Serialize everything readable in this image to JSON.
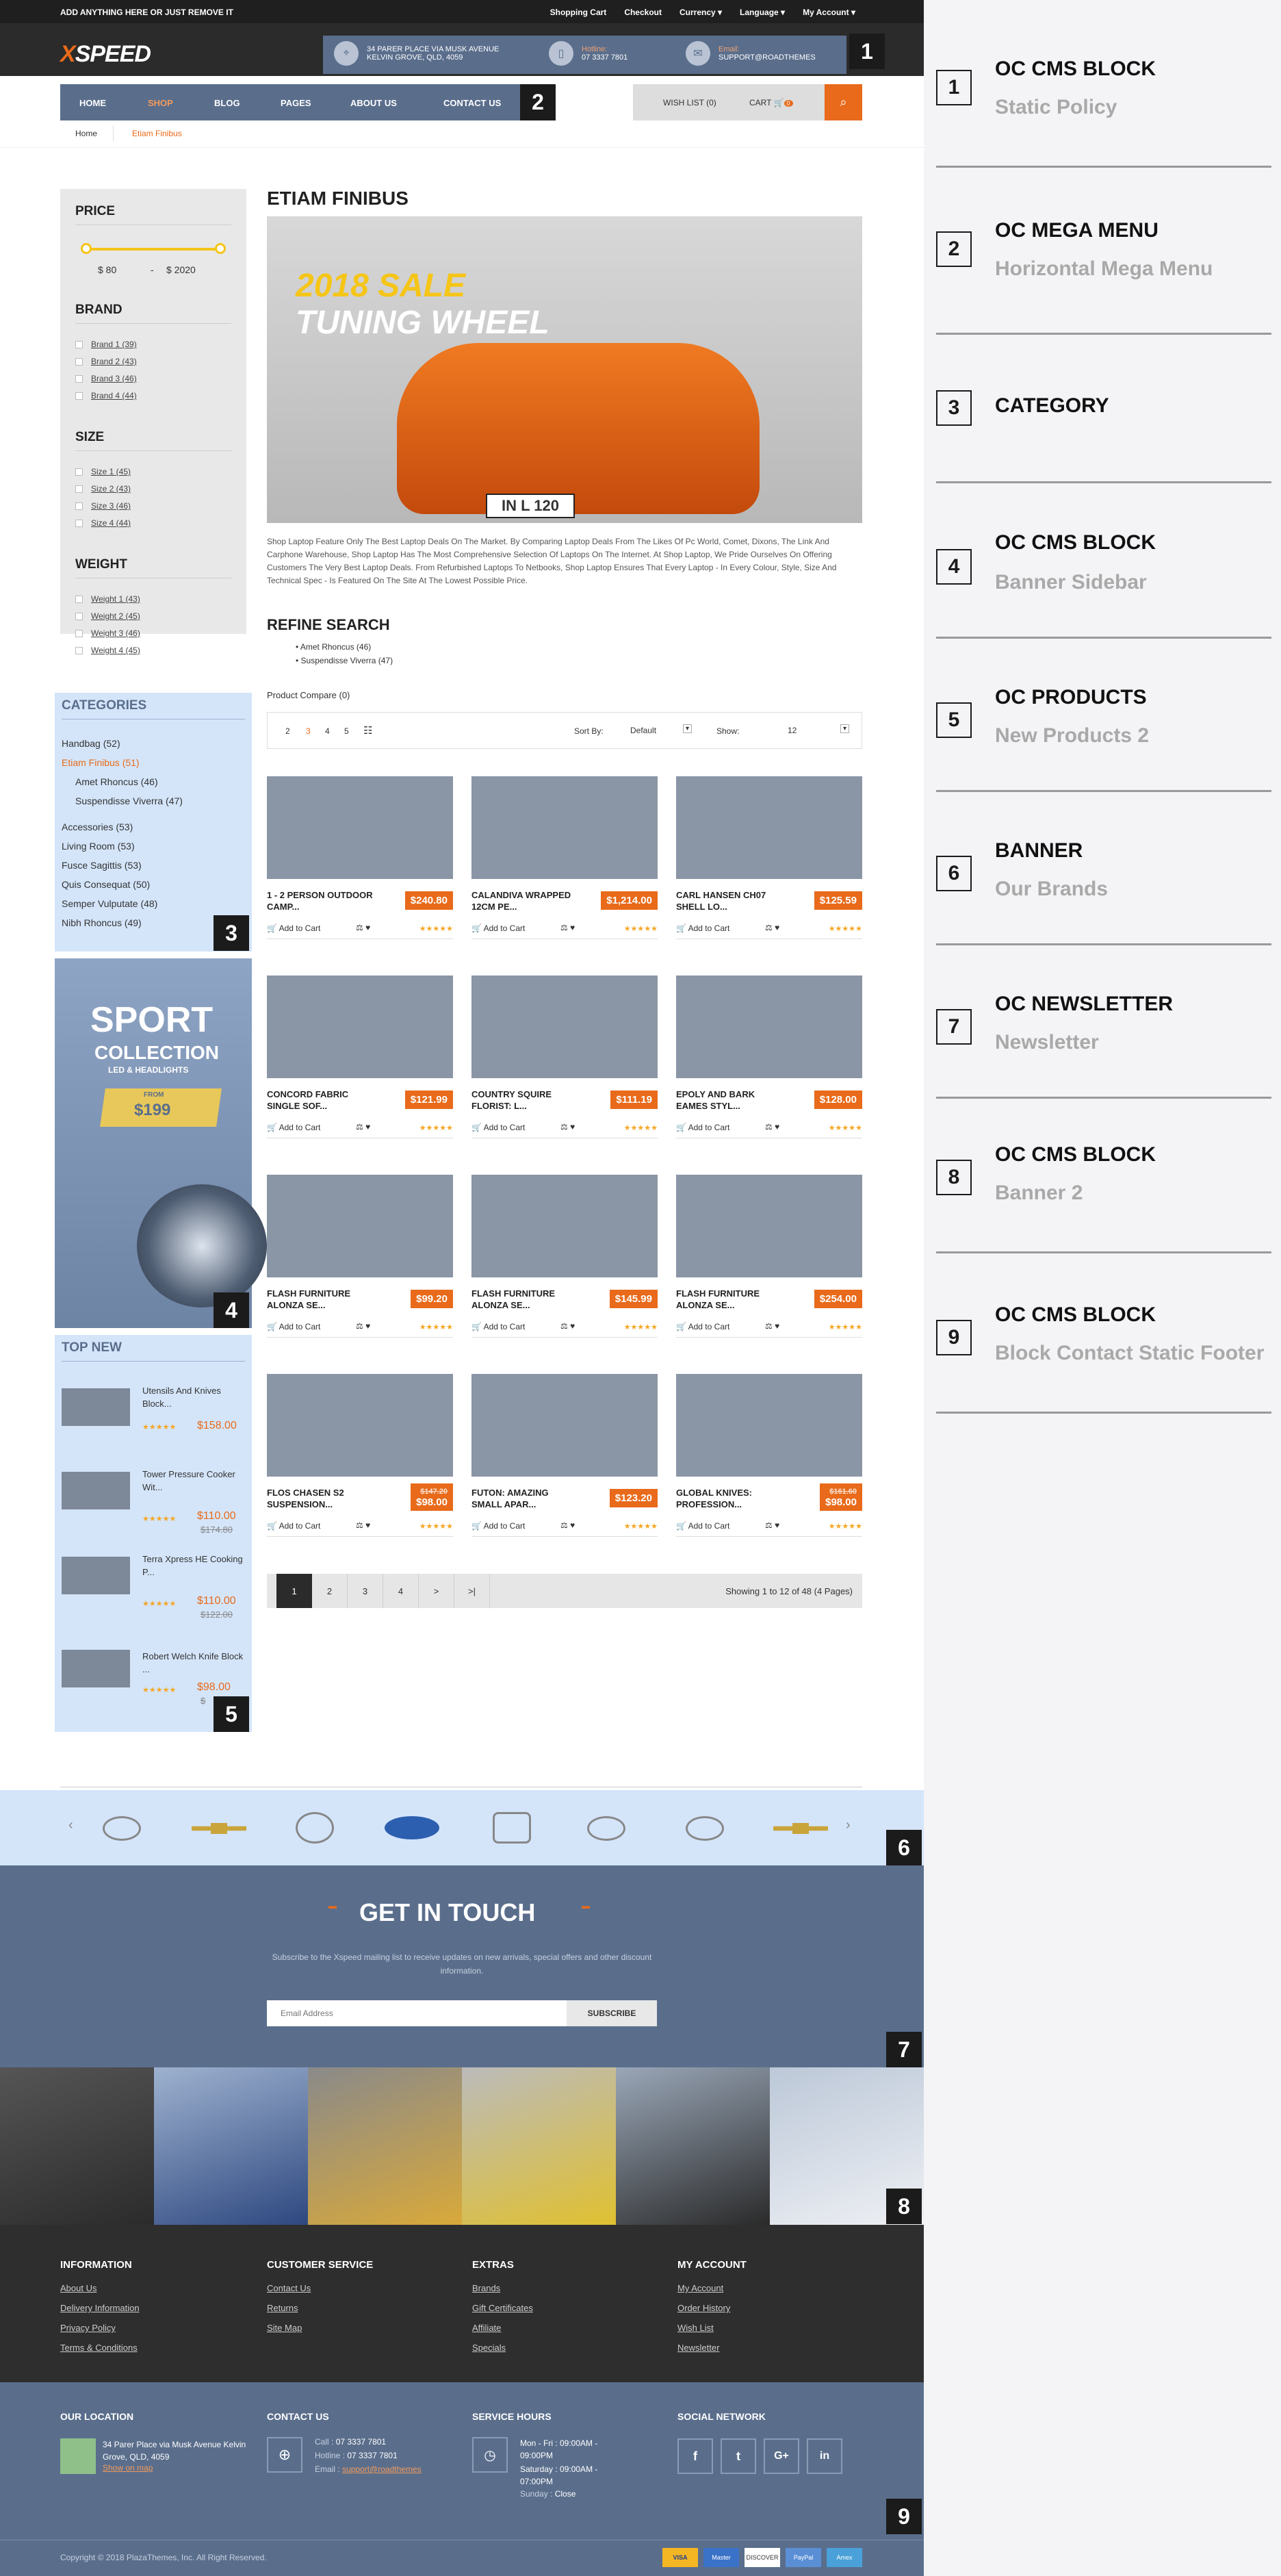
{
  "topbar": {
    "promo": "ADD ANYTHING HERE OR JUST REMOVE IT",
    "links": [
      "Shopping Cart",
      "Checkout",
      "Currency",
      "Language",
      "My Account"
    ]
  },
  "header": {
    "logo_x": "X",
    "logo_rest": "SPEED",
    "address": "34 PARER PLACE VIA MUSK AVENUE",
    "address2": "KELVIN GROVE, QLD, 4059",
    "hotline_label": "Hotline:",
    "hotline": "07 3337 7801",
    "email_label": "Email:",
    "email": "SUPPORT@ROADTHEMES"
  },
  "nav": {
    "items": [
      "HOME",
      "SHOP",
      "BLOG",
      "PAGES",
      "ABOUT US",
      "CONTACT US"
    ],
    "wishlist": "WISH LIST (0)",
    "cart": "CART",
    "cart_count": "0"
  },
  "breadcrumb": [
    "Home",
    "Etiam Finibus"
  ],
  "filter": {
    "price_title": "PRICE",
    "price_min": "$ 80",
    "price_sep": "-",
    "price_max": "$ 2020",
    "brand_title": "BRAND",
    "brands": [
      "Brand 1 (39)",
      "Brand 2 (43)",
      "Brand 3 (46)",
      "Brand 4 (44)"
    ],
    "size_title": "SIZE",
    "sizes": [
      "Size 1 (45)",
      "Size 2 (43)",
      "Size 3 (46)",
      "Size 4 (44)"
    ],
    "weight_title": "WEIGHT",
    "weights": [
      "Weight 1 (43)",
      "Weight 2 (45)",
      "Weight 3 (46)",
      "Weight 4 (45)"
    ]
  },
  "categories": {
    "title": "CATEGORIES",
    "items": [
      "Handbag (52)",
      "Etiam Finibus (51)",
      "Amet Rhoncus (46)",
      "Suspendisse Viverra (47)",
      "Accessories (53)",
      "Living Room (53)",
      "Fusce Sagittis (53)",
      "Quis Consequat (50)",
      "Semper Vulputate (48)",
      "Nibh Rhoncus (49)"
    ]
  },
  "sidebanner": {
    "line1": "SPORT",
    "line2": "COLLECTION",
    "line3": "LED & HEADLIGHTS",
    "from": "FROM",
    "price": "$199"
  },
  "topnew": {
    "title": "TOP NEW",
    "items": [
      {
        "name": "Utensils And Knives Block...",
        "price": "$158.00",
        "old": ""
      },
      {
        "name": "Tower Pressure Cooker Wit...",
        "price": "$110.00",
        "old": "$174.80"
      },
      {
        "name": "Terra Xpress HE Cooking P...",
        "price": "$110.00",
        "old": "$122.00"
      },
      {
        "name": "Robert Welch Knife Block ...",
        "price": "$98.00",
        "old": "$"
      }
    ]
  },
  "main": {
    "title": "ETIAM FINIBUS",
    "banner_year": "2018 SALE",
    "banner_text": "TUNING WHEEL",
    "plate": "IN L 120",
    "desc": "Shop Laptop Feature Only The Best Laptop Deals On The Market. By Comparing Laptop Deals From The Likes Of Pc World, Comet, Dixons, The Link And Carphone Warehouse, Shop Laptop Has The Most Comprehensive Selection Of Laptops On The Internet. At Shop Laptop, We Pride Ourselves On Offering Customers The Very Best Laptop Deals. From Refurbished Laptops To Netbooks, Shop Laptop Ensures That Every Laptop - In Every Colour, Style, Size And Technical Spec - Is Featured On The Site At The Lowest Possible Price.",
    "refine_title": "REFINE SEARCH",
    "refine": [
      "Amet Rhoncus (46)",
      "Suspendisse Viverra (47)"
    ],
    "compare": "Product Compare (0)",
    "pages": [
      "2",
      "3",
      "4",
      "5"
    ],
    "sortby": "Sort By:",
    "sort_val": "Default",
    "show": "Show:",
    "show_val": "12",
    "add_to_cart": "Add to Cart",
    "products": [
      {
        "name": "1 - 2 PERSON OUTDOOR CAMP...",
        "price": "$240.80",
        "old": ""
      },
      {
        "name": "CALANDIVA WRAPPED 12CM PE...",
        "price": "$1,214.00",
        "old": ""
      },
      {
        "name": "CARL HANSEN CH07 SHELL LO...",
        "price": "$125.59",
        "old": ""
      },
      {
        "name": "CONCORD FABRIC SINGLE SOF...",
        "price": "$121.99",
        "old": ""
      },
      {
        "name": "COUNTRY SQUIRE FLORIST: L...",
        "price": "$111.19",
        "old": ""
      },
      {
        "name": "EPOLY AND BARK EAMES STYL...",
        "price": "$128.00",
        "old": ""
      },
      {
        "name": "FLASH FURNITURE ALONZA SE...",
        "price": "$99.20",
        "old": ""
      },
      {
        "name": "FLASH FURNITURE ALONZA SE...",
        "price": "$145.99",
        "old": ""
      },
      {
        "name": "FLASH FURNITURE ALONZA SE...",
        "price": "$254.00",
        "old": ""
      },
      {
        "name": "FLOS CHASEN S2 SUSPENSION...",
        "price": "$98.00",
        "old": "$147.20"
      },
      {
        "name": "FUTON: AMAZING SMALL APAR...",
        "price": "$123.20",
        "old": ""
      },
      {
        "name": "GLOBAL KNIVES: PROFESSION...",
        "price": "$98.00",
        "old": "$161.60"
      }
    ],
    "pagination": [
      "1",
      "2",
      "3",
      "4",
      ">",
      ">|"
    ],
    "showing": "Showing 1 to 12 of 48 (4 Pages)"
  },
  "newsletter": {
    "title": "GET IN TOUCH",
    "text": "Subscribe to the Xspeed mailing list to receive updates on new arrivals, special offers and other discount information.",
    "placeholder": "Email Address",
    "button": "SUBSCRIBE"
  },
  "footer": {
    "cols": [
      {
        "title": "INFORMATION",
        "links": [
          "About Us",
          "Delivery Information",
          "Privacy Policy",
          "Terms & Conditions"
        ]
      },
      {
        "title": "CUSTOMER SERVICE",
        "links": [
          "Contact Us",
          "Returns",
          "Site Map"
        ]
      },
      {
        "title": "EXTRAS",
        "links": [
          "Brands",
          "Gift Certificates",
          "Affiliate",
          "Specials"
        ]
      },
      {
        "title": "MY ACCOUNT",
        "links": [
          "My Account",
          "Order History",
          "Wish List",
          "Newsletter"
        ]
      }
    ],
    "location_title": "OUR LOCATION",
    "location": "34 Parer Place via Musk Avenue Kelvin Grove, QLD, 4059",
    "show_map": "Show on map",
    "contact_title": "CONTACT US",
    "call": "Call :",
    "call_v": "07 3337 7801",
    "hotline": "Hotline :",
    "hotline_v": "07 3337 7801",
    "email": "Email :",
    "email_v": "support@roadthemes",
    "hours_title": "SERVICE HOURS",
    "hours1": "Mon - Fri : 09:00AM - 09:00PM",
    "hours2": "Saturday : 09:00AM - 07:00PM",
    "hours3": "Sunday :",
    "hours3v": "Close",
    "social_title": "SOCIAL NETWORK",
    "social": [
      "f",
      "t",
      "G+",
      "in"
    ],
    "copyright": "Copyright © 2018 PlazaThemes, Inc. All Right Reserved.",
    "payments": [
      "VISA",
      "Master",
      "DISCOVER",
      "PayPal",
      "Amex"
    ]
  },
  "numbers": [
    "1",
    "2",
    "3",
    "4",
    "5",
    "6",
    "7",
    "8",
    "9"
  ],
  "legend": [
    {
      "n": "1",
      "title": "OC CMS BLOCK",
      "sub": "Static Policy"
    },
    {
      "n": "2",
      "title": "OC MEGA MENU",
      "sub": "Horizontal Mega Menu"
    },
    {
      "n": "3",
      "title": "CATEGORY",
      "sub": ""
    },
    {
      "n": "4",
      "title": "OC CMS BLOCK",
      "sub": "Banner Sidebar"
    },
    {
      "n": "5",
      "title": "OC PRODUCTS",
      "sub": "New Products 2"
    },
    {
      "n": "6",
      "title": "BANNER",
      "sub": "Our Brands"
    },
    {
      "n": "7",
      "title": "OC NEWSLETTER",
      "sub": "Newsletter"
    },
    {
      "n": "8",
      "title": "OC CMS BLOCK",
      "sub": "Banner 2"
    },
    {
      "n": "9",
      "title": "OC CMS BLOCK",
      "sub": "Block Contact Static Footer"
    }
  ]
}
